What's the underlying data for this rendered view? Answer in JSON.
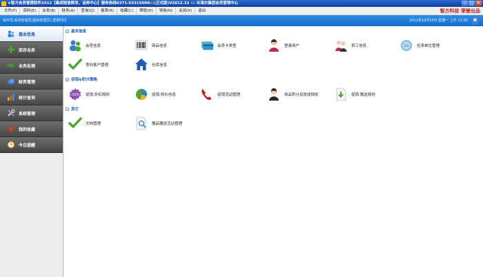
{
  "window": {
    "title": "★智方会员管理软件2012【集成短信群发、话务中心】服务热线0371-63315008:::(正式版)V2012.12 ::: 众海尔集团会员营销中心"
  },
  "menu": [
    "文件(F)",
    "资料(E)",
    "业务(B)",
    "财务(A)",
    "查询(Q)",
    "报表(R)",
    "收藏(C)",
    "帮助(H)",
    "导航(N)",
    "关闭(X)",
    "退出"
  ],
  "brand": "智方科技 荣誉出品",
  "banner": {
    "left": "操作员:系统管理员[超级管理员]   登录时间",
    "right": "2012年10月15日 星期一 上午 12:00"
  },
  "sidebar": [
    {
      "label": "基本信息",
      "icon": "people-icon",
      "color": "#2f7ed8",
      "active": true
    },
    {
      "label": "库存业务",
      "icon": "plus-icon",
      "color": "#4aa631"
    },
    {
      "label": "业务处理",
      "icon": "arrow-right-icon",
      "color": "#3c9b2b"
    },
    {
      "label": "财务管理",
      "icon": "cloud-icon",
      "color": "#3d8fe0"
    },
    {
      "label": "统计查询",
      "icon": "chart-icon",
      "color": "#f0b020"
    },
    {
      "label": "系统管理",
      "icon": "tools-icon",
      "color": "#9aa4b5"
    },
    {
      "label": "我的收藏",
      "icon": "star-icon",
      "color": "#d73a2a"
    },
    {
      "label": "今日提醒",
      "icon": "clock-icon",
      "color": "#f0a020"
    }
  ],
  "sections": [
    {
      "title": "基本信息"
    },
    {
      "title": "促销&积分策略"
    },
    {
      "title": "其它"
    }
  ],
  "modules": {
    "basic": [
      {
        "label": "会员信息",
        "icon": "members-icon"
      },
      {
        "label": "商品信息",
        "icon": "barcode-icon"
      },
      {
        "label": "会员卡类型",
        "icon": "card-icon"
      },
      {
        "label": "登录用户",
        "icon": "user-icon"
      },
      {
        "label": "员工信息",
        "icon": "staff-icon"
      },
      {
        "label": "往来单位管理",
        "icon": "partner-icon"
      },
      {
        "label": "意向客户管理",
        "icon": "check-icon"
      },
      {
        "label": "仓库信息",
        "icon": "warehouse-icon"
      }
    ],
    "promo": [
      {
        "label": "促销.折扣规则",
        "icon": "discount-icon"
      },
      {
        "label": "促销.特价信息",
        "icon": "pie-icon"
      },
      {
        "label": "促销活动管理",
        "icon": "phone-icon"
      },
      {
        "label": "商品积分及提成规则",
        "icon": "person-icon"
      },
      {
        "label": "促销.赠送规则",
        "icon": "download-icon"
      }
    ],
    "other": [
      {
        "label": "文档管理",
        "icon": "doc-check-icon"
      },
      {
        "label": "赠品赠送活动管理",
        "icon": "search-doc-icon"
      }
    ]
  }
}
